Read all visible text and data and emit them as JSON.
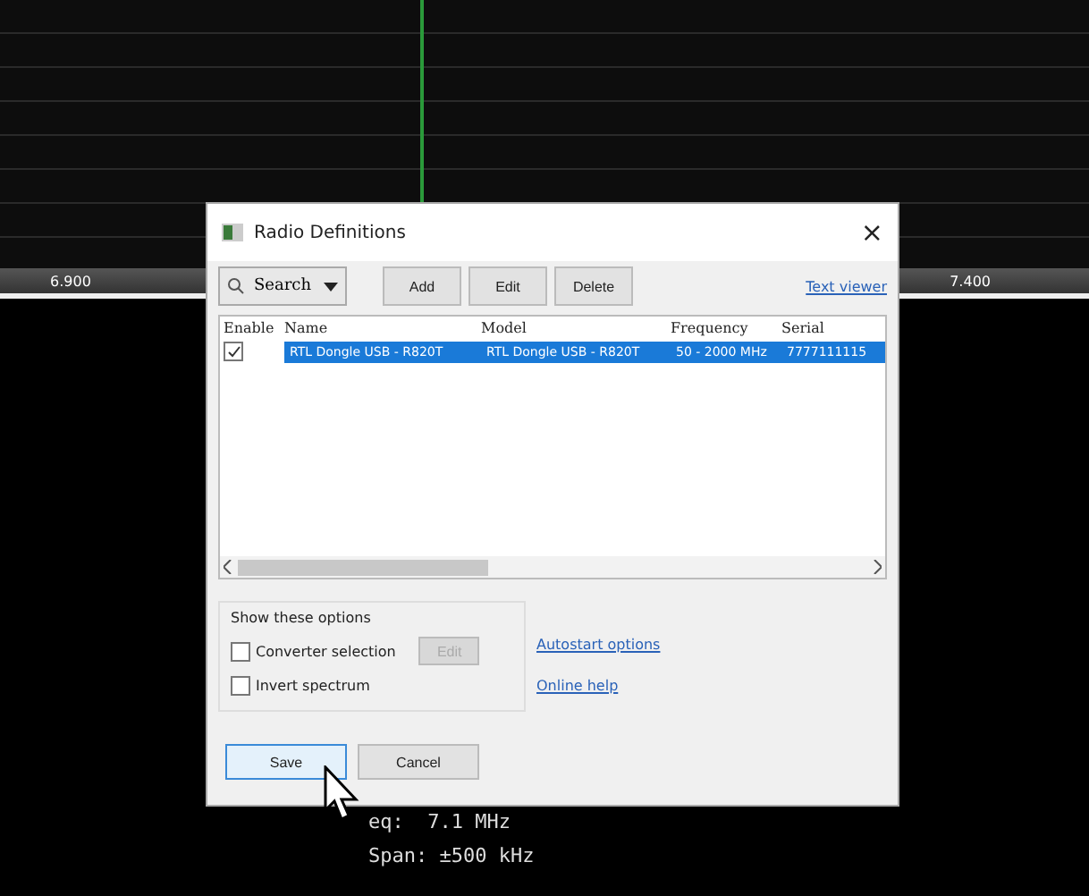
{
  "spectrum": {
    "axis_labels": [
      "6.900",
      "7.400"
    ]
  },
  "readouts": [
    "eq:  7.1 MHz",
    "Span: ±500 kHz"
  ],
  "dialog": {
    "title": "Radio Definitions",
    "close": "×",
    "toolbar": {
      "search": "Search",
      "buttons": [
        "Add",
        "Edit",
        "Delete"
      ],
      "link": "Text viewer"
    },
    "table": {
      "columns": [
        "Enable",
        "Name",
        "Model",
        "Frequency",
        "Serial"
      ],
      "rows": [
        {
          "enabled": true,
          "selected": true,
          "name": "RTL Dongle USB - R820T",
          "model": "RTL Dongle USB - R820T",
          "frequency": "50 - 2000 MHz",
          "serial": "7777111115"
        }
      ]
    },
    "options": {
      "title": "Show these options",
      "items": [
        {
          "label": "Converter selection",
          "checked": false,
          "button": {
            "label": "Edit",
            "disabled": true
          }
        },
        {
          "label": "Invert spectrum",
          "checked": false
        }
      ]
    },
    "links": [
      "Autostart options",
      "Online help"
    ],
    "buttons": [
      {
        "label": "Save",
        "selected": true
      },
      {
        "label": "Cancel",
        "selected": false
      }
    ]
  }
}
